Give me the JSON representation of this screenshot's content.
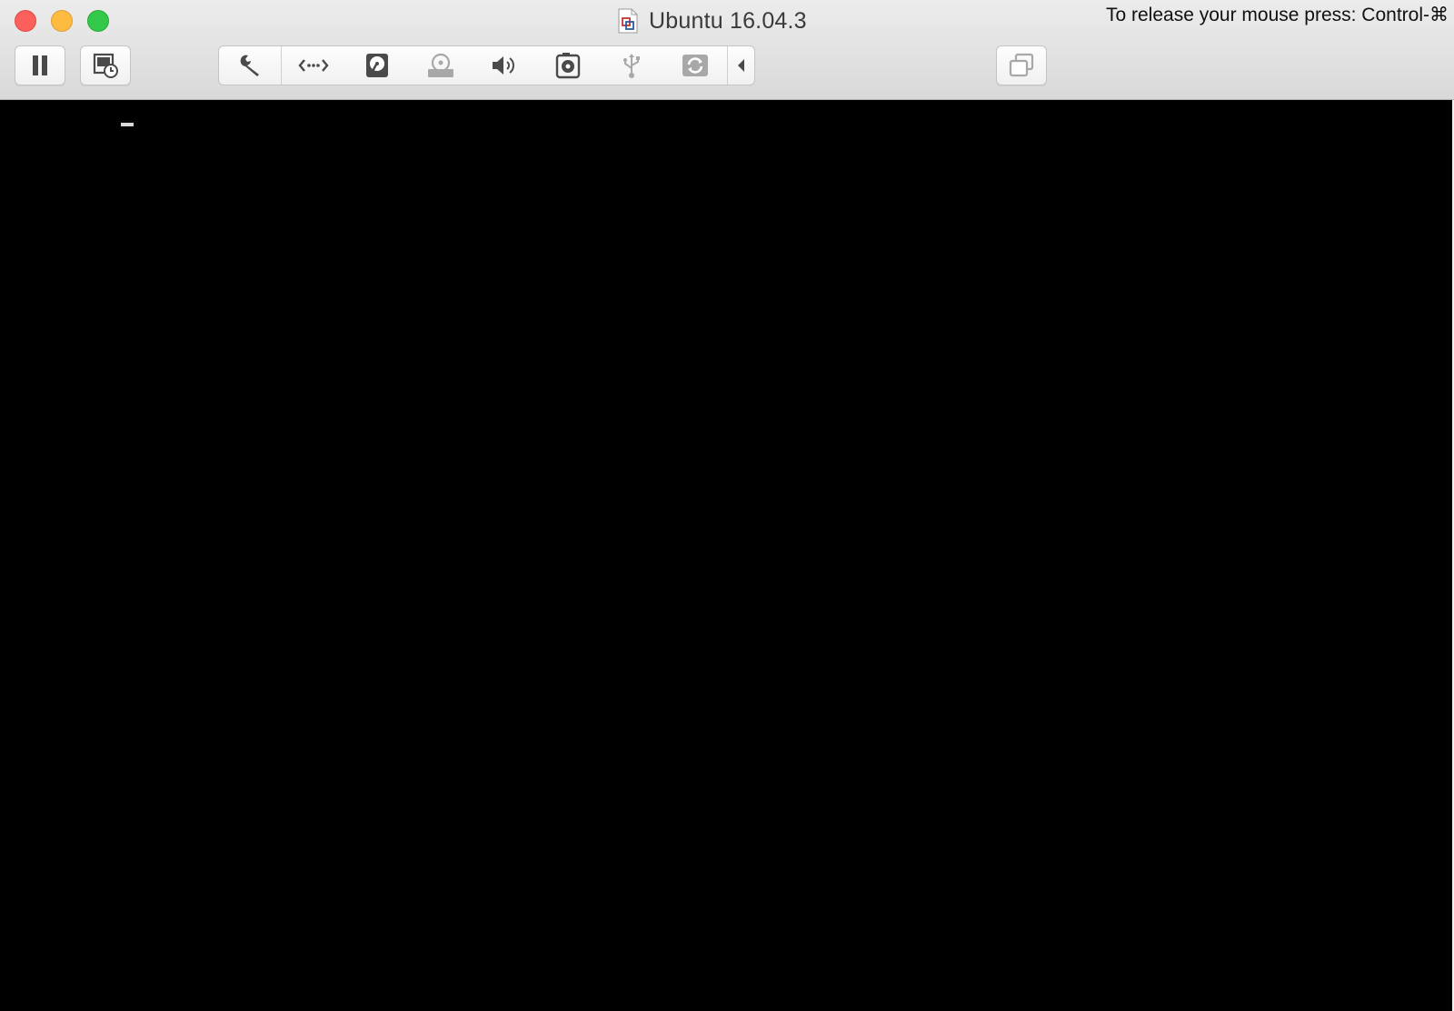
{
  "window": {
    "title": "Ubuntu 16.04.3",
    "release_message": "To release your mouse press: Control-⌘"
  },
  "toolbar": {
    "left_buttons": [
      {
        "name": "pause-button",
        "icon": "pause-icon"
      },
      {
        "name": "snapshot-button",
        "icon": "snapshot-icon"
      }
    ],
    "devices": [
      {
        "name": "settings-button",
        "icon": "wrench-icon"
      },
      {
        "name": "network-button",
        "icon": "network-icon"
      },
      {
        "name": "hard-disk-button",
        "icon": "hard-disk-icon"
      },
      {
        "name": "cd-dvd-button",
        "icon": "disc-icon"
      },
      {
        "name": "sound-button",
        "icon": "speaker-icon"
      },
      {
        "name": "camera-button",
        "icon": "camera-icon"
      },
      {
        "name": "usb-button",
        "icon": "usb-icon"
      },
      {
        "name": "shared-folders-button",
        "icon": "shared-folders-icon"
      },
      {
        "name": "collapse-button",
        "icon": "chevron-left-icon"
      }
    ],
    "right_buttons": [
      {
        "name": "unity-button",
        "icon": "windows-stack-icon"
      }
    ]
  },
  "colors": {
    "close": "#fc605c",
    "minimize": "#fdbc40",
    "zoom": "#34c84a",
    "icon_dark": "#4a4a4a",
    "icon_light": "#a8a8a8",
    "screen": "#000000"
  },
  "console": {
    "cursor_visible": true
  }
}
